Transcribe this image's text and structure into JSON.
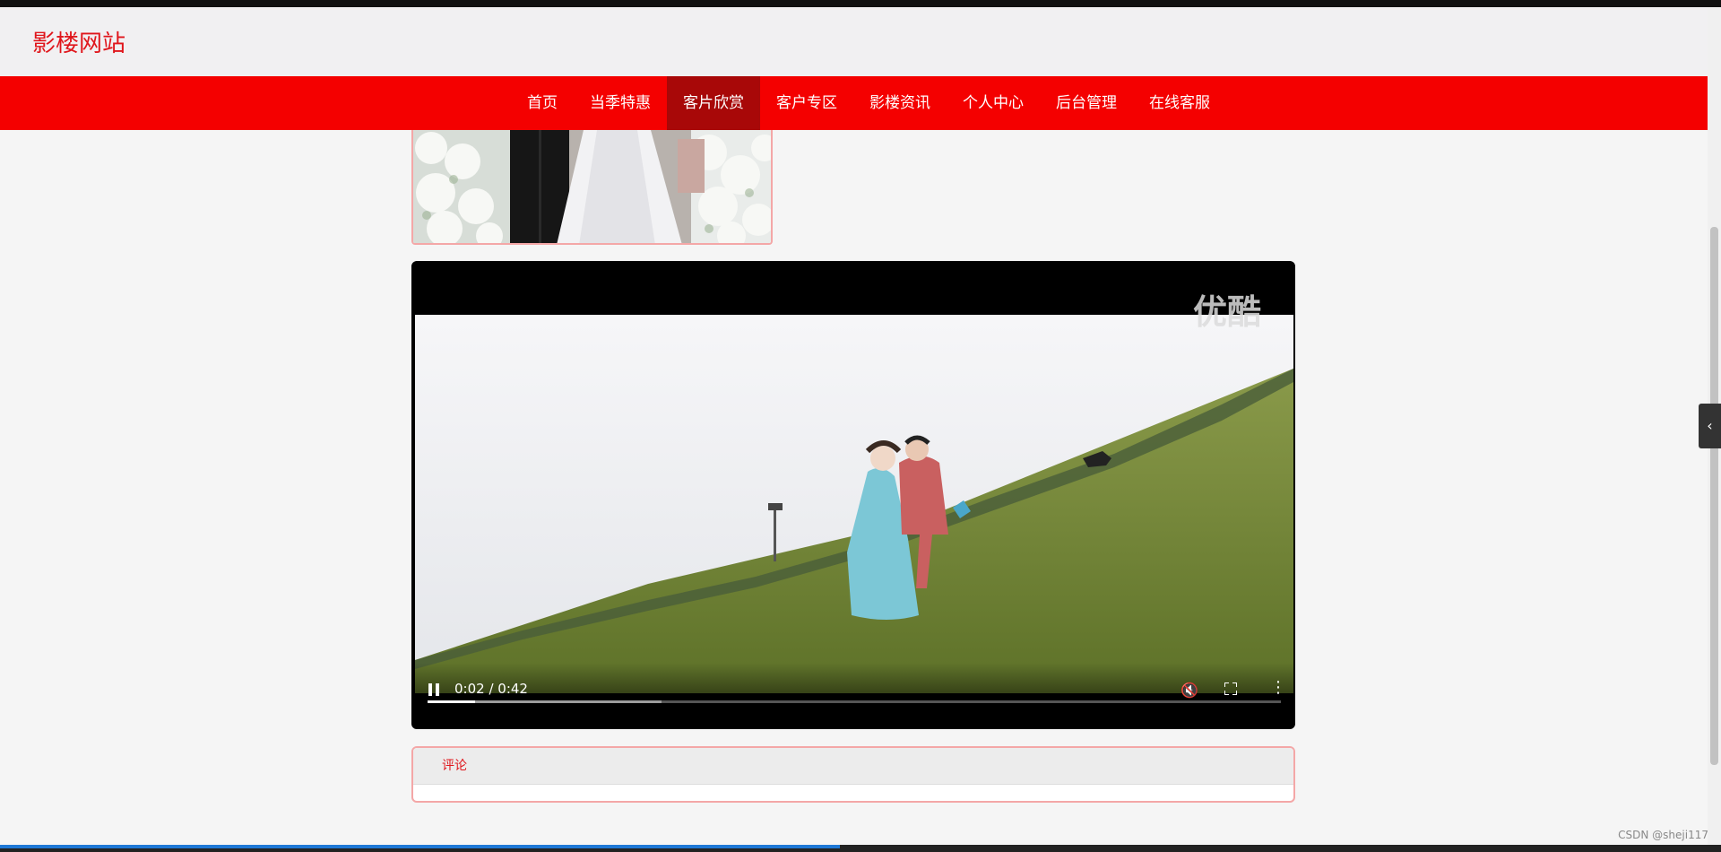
{
  "site": {
    "logo": "影楼网站"
  },
  "nav": {
    "items": [
      "首页",
      "当季特惠",
      "客片欣赏",
      "客户专区",
      "影楼资讯",
      "个人中心",
      "后台管理",
      "在线客服"
    ],
    "active_index": 2,
    "color": "#f40000",
    "active_color": "#a80808"
  },
  "video": {
    "watermark": "优酷",
    "time": "0:02 / 0:42",
    "playing": true,
    "played_fraction": 0.056,
    "buffered_fraction": 0.274,
    "icons": {
      "pause": "pause-icon",
      "volume": "volume-icon",
      "fullscreen": "fullscreen-icon",
      "more": "more-options-icon"
    }
  },
  "comment": {
    "title": "评论"
  },
  "side_tab": {
    "label": "‹"
  },
  "footer": {
    "credit": "CSDN @sheji117"
  }
}
